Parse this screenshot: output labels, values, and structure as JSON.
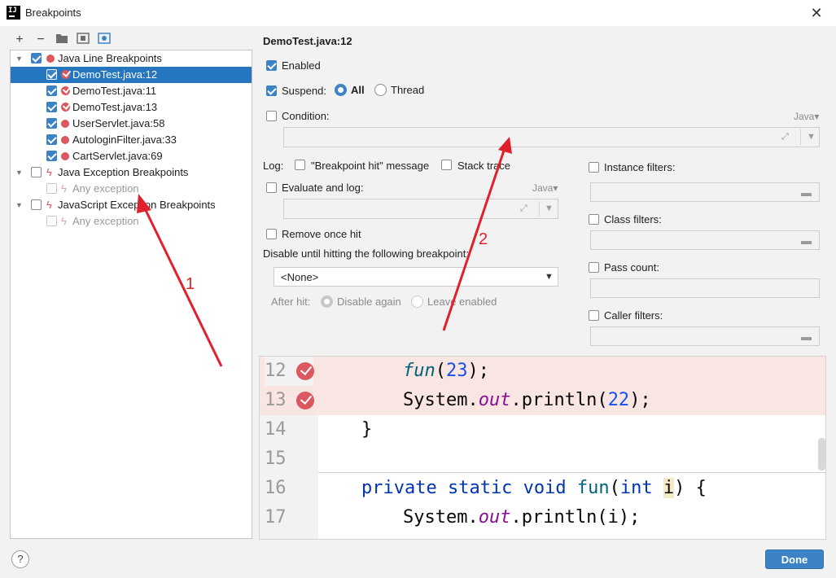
{
  "window": {
    "title": "Breakpoints",
    "close_glyph": "✕"
  },
  "toolbar": {
    "add": "+",
    "remove": "−",
    "icons": [
      "plus-icon",
      "minus-icon",
      "folder-icon",
      "group-icon",
      "view-icon"
    ]
  },
  "tree": {
    "groups": [
      {
        "label": "Java Line Breakpoints",
        "checked": true,
        "items": [
          {
            "label": "DemoTest.java:12",
            "checked": true,
            "selected": true
          },
          {
            "label": "DemoTest.java:11",
            "checked": true
          },
          {
            "label": "DemoTest.java:13",
            "checked": true
          },
          {
            "label": "UserServlet.java:58",
            "checked": true
          },
          {
            "label": "AutologinFilter.java:33",
            "checked": true
          },
          {
            "label": "CartServlet.java:69",
            "checked": true
          }
        ]
      },
      {
        "label": "Java Exception Breakpoints",
        "checked": false,
        "items": [
          {
            "label": "Any exception",
            "checked": false
          }
        ]
      },
      {
        "label": "JavaScript Exception Breakpoints",
        "checked": false,
        "items": [
          {
            "label": "Any exception",
            "checked": false
          }
        ]
      }
    ]
  },
  "details": {
    "header": "DemoTest.java:12",
    "enabled_label": "Enabled",
    "suspend_label": "Suspend:",
    "suspend_all": "All",
    "suspend_thread": "Thread",
    "condition_label": "Condition:",
    "condition_lang": "Java",
    "log_label": "Log:",
    "log_hit_message": "\"Breakpoint hit\" message",
    "log_stack_trace": "Stack trace",
    "evaluate_label": "Evaluate and log:",
    "evaluate_lang": "Java",
    "remove_once_hit": "Remove once hit",
    "disable_until_label": "Disable until hitting the following breakpoint:",
    "disable_until_value": "<None>",
    "after_hit_label": "After hit:",
    "after_hit_disable_again": "Disable again",
    "after_hit_leave_enabled": "Leave enabled",
    "instance_filters": "Instance filters:",
    "class_filters": "Class filters:",
    "pass_count": "Pass count:",
    "caller_filters": "Caller filters:"
  },
  "editor": {
    "lines": [
      {
        "num": "12",
        "breakpoint": true
      },
      {
        "num": "13",
        "breakpoint": true
      },
      {
        "num": "14",
        "breakpoint": false
      },
      {
        "num": "15",
        "breakpoint": false
      },
      {
        "num": "16",
        "breakpoint": false
      },
      {
        "num": "17",
        "breakpoint": false
      }
    ],
    "tokens": {
      "l12_fn": "fun",
      "l12_open": "(",
      "l12_num": "23",
      "l12_close": ");",
      "l13_sys": "System.",
      "l13_out": "out",
      "l13_rest": ".println(",
      "l13_num": "22",
      "l13_close": ");",
      "l14": "}",
      "l16_kw": "private static void ",
      "l16_fn": "fun",
      "l16_open": "(",
      "l16_int": "int ",
      "l16_param": "i",
      "l16_close": ") {",
      "l17_sys": "System.",
      "l17_out": "out",
      "l17_rest": ".println(i);"
    }
  },
  "footer": {
    "help": "?",
    "done": "Done"
  },
  "annotations": {
    "one": "1",
    "two": "2"
  },
  "colors": {
    "accent": "#3c83c5",
    "selection": "#2675bf",
    "breakpoint": "#db5860",
    "annotation": "#e0202a",
    "highlight": "#f9e5e1"
  }
}
